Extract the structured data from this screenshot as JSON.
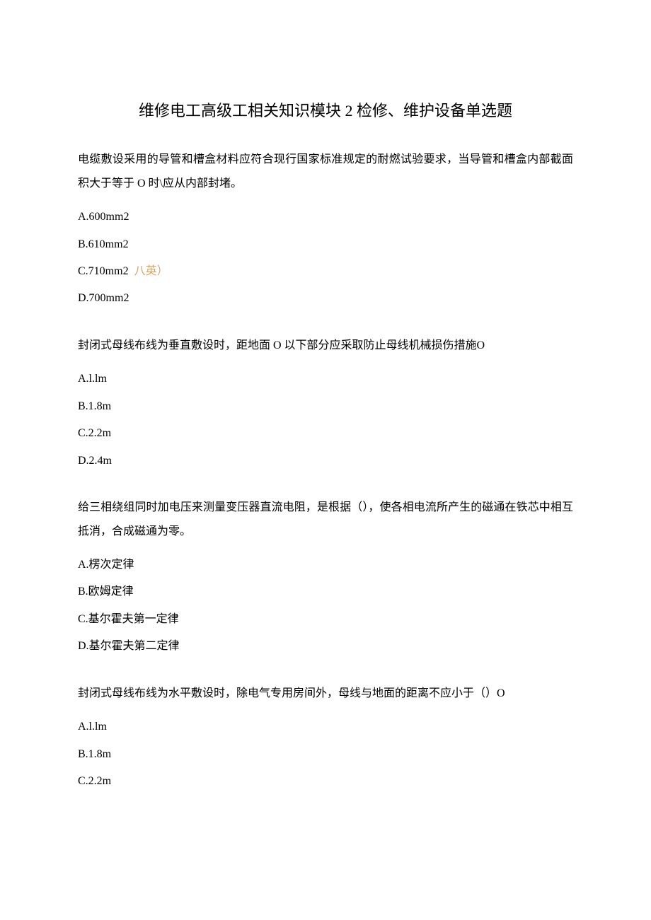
{
  "title": "维修电工高级工相关知识模块 2 检修、维护设备单选题",
  "questions": [
    {
      "text": "电缆敷设采用的导管和槽盒材料应符合现行国家标准规定的耐燃试验要求，当导管和槽盒内部截面积大于等于 O 时\\应从内部封堵。",
      "options": [
        {
          "label": "A.600mm2",
          "annotation": ""
        },
        {
          "label": "B.610mm2",
          "annotation": ""
        },
        {
          "label": "C.710mm2",
          "annotation": " 八英）"
        },
        {
          "label": "D.700mm2",
          "annotation": ""
        }
      ]
    },
    {
      "text": "封闭式母线布线为垂直敷设时，距地面 O 以下部分应采取防止母线机械损伤措施O",
      "options": [
        {
          "label": "A.l.lm",
          "annotation": ""
        },
        {
          "label": "B.1.8m",
          "annotation": ""
        },
        {
          "label": "C.2.2m",
          "annotation": ""
        },
        {
          "label": "D.2.4m",
          "annotation": ""
        }
      ]
    },
    {
      "text": "给三相绕组同时加电压来测量变压器直流电阻，是根据（），使各相电流所产生的磁通在铁芯中相互抵消，合成磁通为零。",
      "options": [
        {
          "label": "A.楞次定律",
          "annotation": ""
        },
        {
          "label": "B.欧姆定律",
          "annotation": ""
        },
        {
          "label": "C.基尔霍夫第一定律",
          "annotation": ""
        },
        {
          "label": "D.基尔霍夫第二定律",
          "annotation": ""
        }
      ]
    },
    {
      "text": "封闭式母线布线为水平敷设时，除电气专用房间外，母线与地面的距离不应小于（）O",
      "options": [
        {
          "label": "A.l.lm",
          "annotation": ""
        },
        {
          "label": "B.1.8m",
          "annotation": ""
        },
        {
          "label": "C.2.2m",
          "annotation": ""
        }
      ]
    }
  ]
}
